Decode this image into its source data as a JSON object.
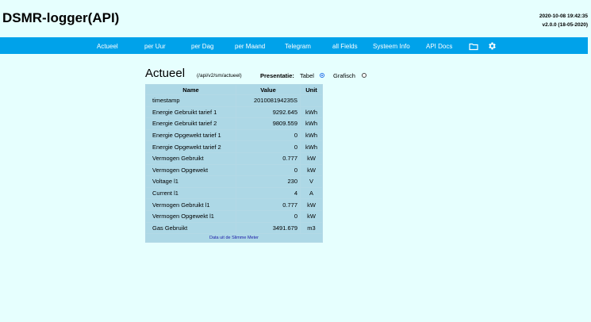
{
  "header": {
    "title": "DSMR-logger(API)",
    "datetime": "2020-10-08 19:42:35",
    "version": "v2.0.0 (18-05-2020)"
  },
  "nav": {
    "items": [
      {
        "label": "Actueel"
      },
      {
        "label": "per Uur"
      },
      {
        "label": "per Dag"
      },
      {
        "label": "per Maand"
      },
      {
        "label": "Telegram"
      },
      {
        "label": "all Fields"
      },
      {
        "label": "Systeem Info"
      },
      {
        "label": "API Docs"
      }
    ],
    "icons": [
      "folder-icon",
      "gear-icon"
    ]
  },
  "page": {
    "title": "Actueel",
    "api_path": "(/api/v2/sm/actueel)",
    "presentation_label": "Presentatie:",
    "options": [
      {
        "label": "Tabel",
        "selected": true
      },
      {
        "label": "Grafisch",
        "selected": false
      }
    ]
  },
  "table": {
    "headers": [
      "Name",
      "Value",
      "Unit"
    ],
    "rows": [
      {
        "name": "timestamp",
        "value": "201008194235S",
        "unit": ""
      },
      {
        "name": "Energie Gebruikt tarief 1",
        "value": "9292.645",
        "unit": "kWh"
      },
      {
        "name": "Energie Gebruikt tarief 2",
        "value": "9809.559",
        "unit": "kWh"
      },
      {
        "name": "Energie Opgewekt tarief 1",
        "value": "0",
        "unit": "kWh"
      },
      {
        "name": "Energie Opgewekt tarief 2",
        "value": "0",
        "unit": "kWh"
      },
      {
        "name": "Vermogen Gebruikt",
        "value": "0.777",
        "unit": "kW"
      },
      {
        "name": "Vermogen Opgewekt",
        "value": "0",
        "unit": "kW"
      },
      {
        "name": "Voltage l1",
        "value": "230",
        "unit": "V"
      },
      {
        "name": "Current l1",
        "value": "4",
        "unit": "A"
      },
      {
        "name": "Vermogen Gebruikt l1",
        "value": "0.777",
        "unit": "kW"
      },
      {
        "name": "Vermogen Opgewekt l1",
        "value": "0",
        "unit": "kW"
      },
      {
        "name": "Gas Gebruikt",
        "value": "3491.679",
        "unit": "m3"
      }
    ],
    "footer": "Data uit de Slimme Meter"
  },
  "colors": {
    "background": "#e6fffe",
    "navbar": "#00a2ea",
    "table_cell": "#add8e6",
    "footer_text": "#1a1aa6"
  }
}
